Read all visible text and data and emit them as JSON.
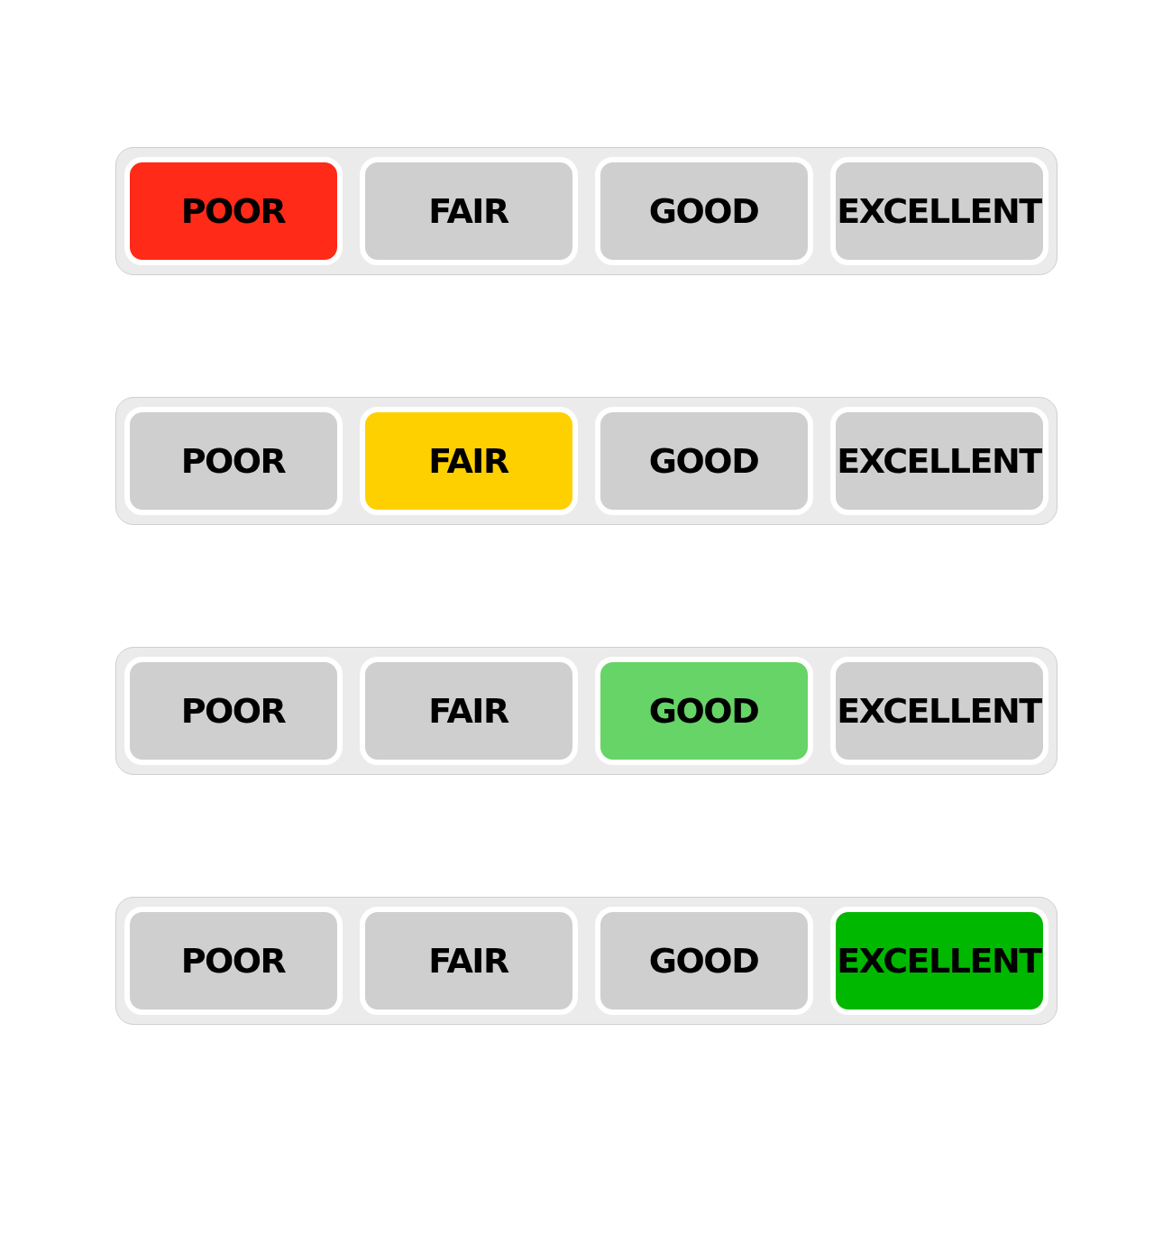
{
  "rating_bars": [
    {
      "color": "#ff2a17",
      "options": [
        {
          "label": "POOR",
          "selected": true
        },
        {
          "label": "FAIR",
          "selected": false
        },
        {
          "label": "GOOD",
          "selected": false
        },
        {
          "label": "EXCELLENT",
          "selected": false
        }
      ]
    },
    {
      "color": "#ffd000",
      "options": [
        {
          "label": "POOR",
          "selected": false
        },
        {
          "label": "FAIR",
          "selected": true
        },
        {
          "label": "GOOD",
          "selected": false
        },
        {
          "label": "EXCELLENT",
          "selected": false
        }
      ]
    },
    {
      "color": "#66d466",
      "options": [
        {
          "label": "POOR",
          "selected": false
        },
        {
          "label": "FAIR",
          "selected": false
        },
        {
          "label": "GOOD",
          "selected": true
        },
        {
          "label": "EXCELLENT",
          "selected": false
        }
      ]
    },
    {
      "color": "#00b800",
      "options": [
        {
          "label": "POOR",
          "selected": false
        },
        {
          "label": "FAIR",
          "selected": false
        },
        {
          "label": "GOOD",
          "selected": false
        },
        {
          "label": "EXCELLENT",
          "selected": true
        }
      ]
    }
  ]
}
